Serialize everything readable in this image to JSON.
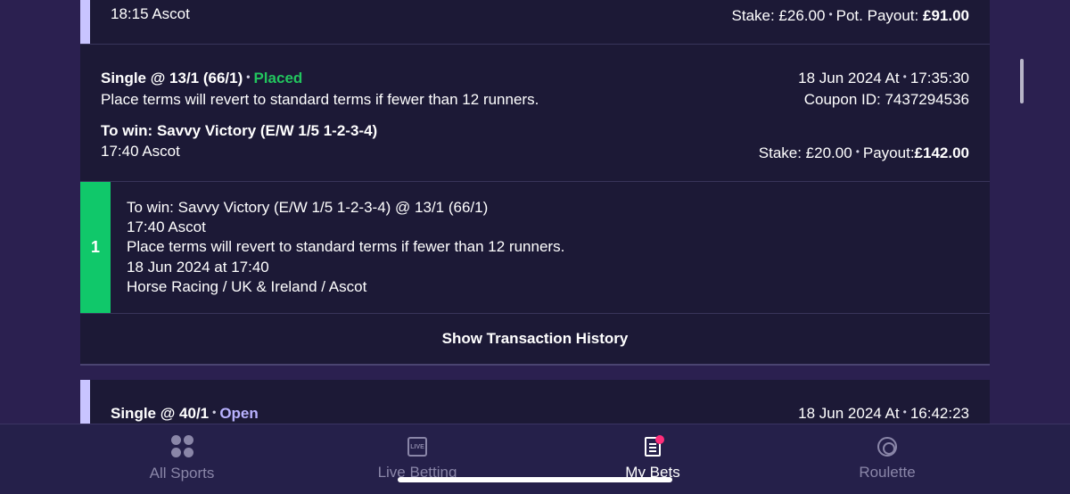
{
  "bet_prev": {
    "race": "18:15 Ascot",
    "stake_label": "Stake: £26.00",
    "payout_label": "Pot. Payout:",
    "payout_value": "£91.00"
  },
  "bet_placed": {
    "title": "Single @ 13/1 (66/1)",
    "status": "Placed",
    "date": "18 Jun 2024 At",
    "time": "17:35:30",
    "terms": "Place terms will revert to standard terms if fewer than 12 runners.",
    "coupon": "Coupon ID: 7437294536",
    "selection": "To win: Savvy Victory (E/W 1/5 1-2-3-4)",
    "race": "17:40 Ascot",
    "stake_label": "Stake: £20.00",
    "payout_label": "Payout:",
    "payout_value": "£142.00",
    "leg": {
      "number": "1",
      "selection": "To win: Savvy Victory (E/W 1/5 1-2-3-4) @ 13/1 (66/1)",
      "race": "17:40 Ascot",
      "terms": "Place terms will revert to standard terms if fewer than 12 runners.",
      "datetime": "18 Jun 2024 at 17:40",
      "path": "Horse Racing / UK & Ireland / Ascot"
    },
    "history_button": "Show Transaction History"
  },
  "bet_open": {
    "title": "Single @ 40/1",
    "status": "Open",
    "date": "18 Jun 2024 At",
    "time": "16:42:23"
  },
  "nav": {
    "items": [
      {
        "label": "All Sports",
        "icon": "all-sports-icon"
      },
      {
        "label": "Live Betting",
        "icon": "live-icon",
        "icon_text": "LIVE"
      },
      {
        "label": "My Bets",
        "icon": "bet-slip-icon"
      },
      {
        "label": "Roulette",
        "icon": "roulette-icon"
      }
    ],
    "active": "My Bets"
  },
  "colors": {
    "background": "#2b2050",
    "card": "#1c1936",
    "placed": "#22c55e",
    "open": "#b9b2ff",
    "leg_marker": "#10c86a",
    "badge": "#ff2d7a"
  }
}
